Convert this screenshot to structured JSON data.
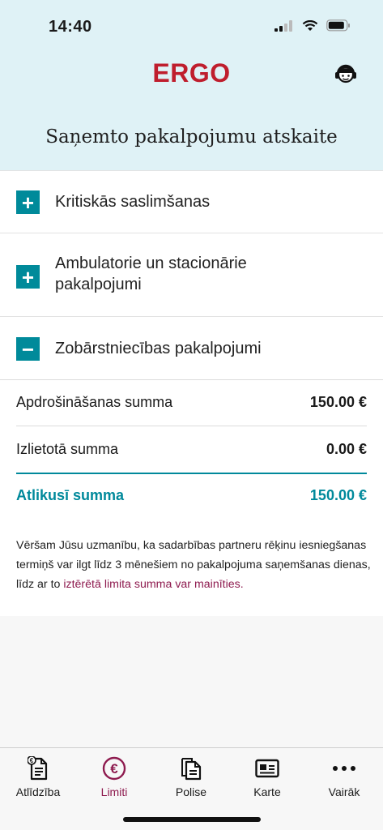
{
  "status_bar": {
    "time": "14:40"
  },
  "header": {
    "logo": "ERGO",
    "title": "Saņemto pakalpojumu atskaite"
  },
  "accordion": [
    {
      "label": "Kritiskās saslimšanas",
      "icon": "+"
    },
    {
      "label": "Ambulatorie un stacionārie pakalpojumi",
      "icon": "+"
    },
    {
      "label": "Zobārstniecības pakalpojumi",
      "icon": "−"
    }
  ],
  "summary": {
    "insured_label": "Apdrošināšanas summa",
    "insured_value": "150.00 €",
    "used_label": "Izlietotā summa",
    "used_value": "0.00 €",
    "remaining_label": "Atlikusī summa",
    "remaining_value": "150.00 €"
  },
  "notice": {
    "text": "Vēršam Jūsu uzmanību, ka sadarbības partneru rēķinu iesniegšanas termiņš var ilgt līdz 3 mēnešiem no pakalpojuma saņemšanas dienas, līdz ar to ",
    "link": "iztērētā limita summa var mainīties."
  },
  "tabs": [
    {
      "label": "Atlīdzība",
      "icon": "claim-document-icon"
    },
    {
      "label": "Limiti",
      "icon": "euro-circle-icon",
      "active": true
    },
    {
      "label": "Polise",
      "icon": "policy-documents-icon"
    },
    {
      "label": "Karte",
      "icon": "id-card-icon"
    },
    {
      "label": "Vairāk",
      "icon": "more-dots-icon"
    }
  ],
  "colors": {
    "brand_red": "#bf1e2d",
    "accent_teal": "#00899b",
    "active_tab": "#8e1b4f",
    "header_bg": "#dff2f6"
  }
}
